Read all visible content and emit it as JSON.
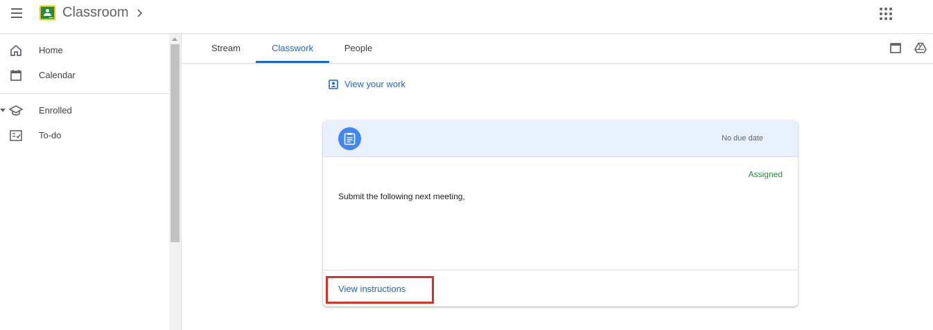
{
  "header": {
    "app_title": "Classroom",
    "icons": [
      "menu-icon",
      "classroom-logo",
      "chevron-right-icon",
      "apps-grid-icon"
    ]
  },
  "sidebar": {
    "items": [
      {
        "label": "Home",
        "icon": "home-icon"
      },
      {
        "label": "Calendar",
        "icon": "calendar-icon"
      },
      {
        "label": "Enrolled",
        "icon": "graduation-cap-icon",
        "expanded": true
      },
      {
        "label": "To-do",
        "icon": "todo-checklist-icon"
      }
    ]
  },
  "tabs": {
    "items": [
      {
        "label": "Stream",
        "active": false
      },
      {
        "label": "Classwork",
        "active": true
      },
      {
        "label": "People",
        "active": false
      }
    ],
    "right_icons": [
      "calendar-icon",
      "drive-icon"
    ]
  },
  "classwork": {
    "view_work_label": "View your work",
    "card": {
      "due_text": "No due date",
      "status": "Assigned",
      "description": "Submit the following next meeting,",
      "footer_link": "View instructions"
    }
  },
  "colors": {
    "accent": "#1967d2",
    "status_green": "#1e8e3e",
    "card_header_bg": "#e8f0fe",
    "highlight_red": "#d93025"
  }
}
